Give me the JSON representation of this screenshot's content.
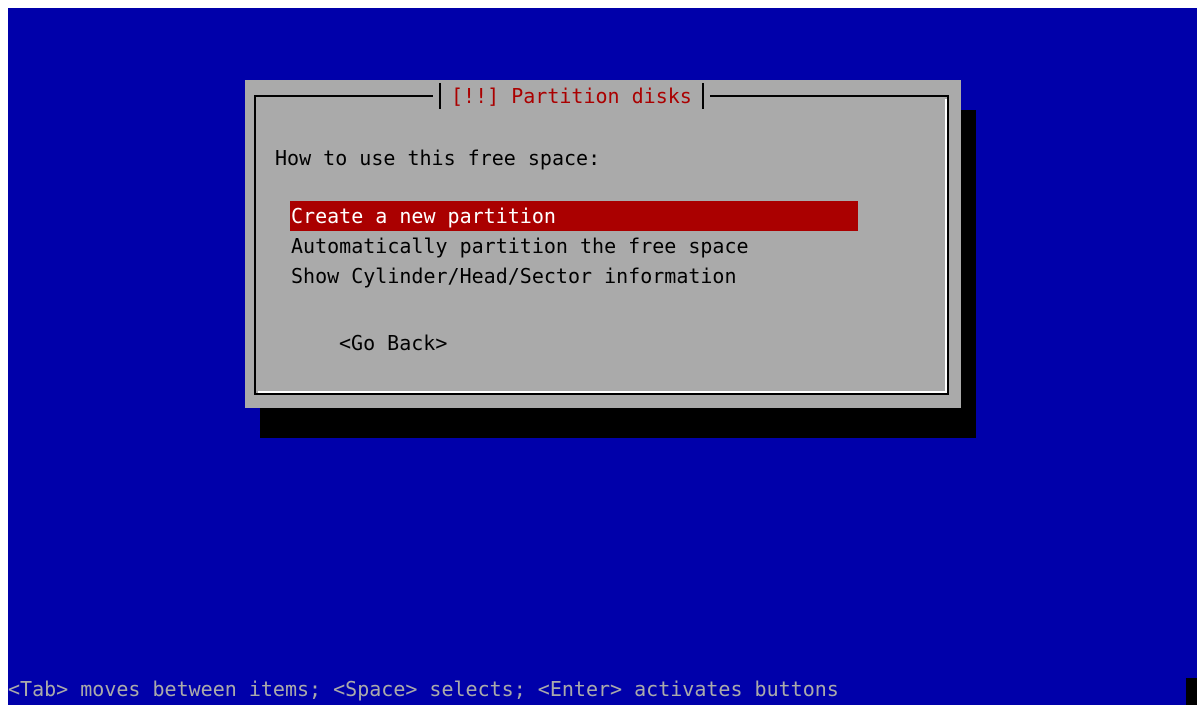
{
  "colors": {
    "screen_bg": "#0000aa",
    "dialog_bg": "#aaaaaa",
    "title_fg": "#aa0000",
    "selected_bg": "#aa0000",
    "selected_fg": "#ffffff",
    "help_fg": "#aaaaaa"
  },
  "dialog": {
    "title": "[!!] Partition disks",
    "question": "How to use this free space:",
    "options": [
      {
        "label": "Create a new partition",
        "selected": true
      },
      {
        "label": "Automatically partition the free space",
        "selected": false
      },
      {
        "label": "Show Cylinder/Head/Sector information",
        "selected": false
      }
    ],
    "back_button": "<Go Back>"
  },
  "help_line": "<Tab> moves between items; <Space> selects; <Enter> activates buttons"
}
